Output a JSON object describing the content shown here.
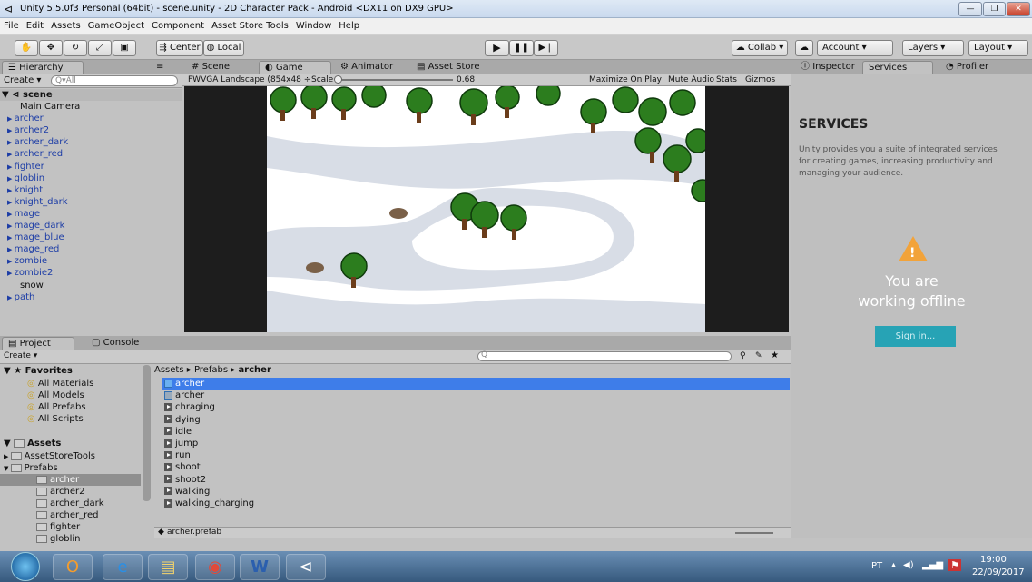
{
  "window": {
    "title": "Unity 5.5.0f3 Personal (64bit) - scene.unity - 2D Character Pack - Android <DX11 on DX9 GPU>",
    "controls": [
      "min",
      "max",
      "close"
    ]
  },
  "menubar": [
    "File",
    "Edit",
    "Assets",
    "GameObject",
    "Component",
    "Asset Store Tools",
    "Window",
    "Help"
  ],
  "toolbar": {
    "tools": [
      "hand",
      "move",
      "rotate",
      "scale",
      "rect"
    ],
    "pivot": "Center",
    "space": "Local",
    "collab": "Collab ▾",
    "account": "Account",
    "layers": "Layers",
    "layout": "Layout"
  },
  "hierarchy": {
    "tab": "Hierarchy",
    "create": "Create ▾",
    "search_placeholder": "Q▾All",
    "scene": "scene",
    "items": [
      "Main Camera",
      "archer",
      "archer2",
      "archer_dark",
      "archer_red",
      "fighter",
      "globlin",
      "knight",
      "knight_dark",
      "mage",
      "mage_dark",
      "mage_blue",
      "mage_red",
      "zombie",
      "zombie2",
      "snow",
      "path"
    ]
  },
  "center_tabs": [
    "Scene",
    "Game",
    "Animator",
    "Asset Store"
  ],
  "game_bar": {
    "resolution": "FWVGA Landscape (854x48 ÷",
    "scale_label": "Scale",
    "scale_value": "0.68",
    "maximize": "Maximize On Play",
    "mute": "Mute Audio",
    "stats": "Stats",
    "gizmos": "Gizmos"
  },
  "right_tabs": [
    "Inspector",
    "Services",
    "Profiler"
  ],
  "services": {
    "heading": "SERVICES",
    "description": "Unity provides you a suite of integrated services for creating games, increasing productivity and managing your audience.",
    "offline_line1": "You are",
    "offline_line2": "working offline",
    "signin": "Sign in..."
  },
  "project": {
    "tabs": [
      "Project",
      "Console"
    ],
    "create": "Create ▾",
    "favorites_label": "Favorites",
    "favorites": [
      "All Materials",
      "All Models",
      "All Prefabs",
      "All Scripts"
    ],
    "assets_label": "Assets",
    "assets_tree": [
      "AssetStoreTools",
      "Prefabs",
      "archer",
      "archer2",
      "archer_dark",
      "archer_red",
      "fighter",
      "globlin"
    ],
    "breadcrumb": [
      "Assets",
      "Prefabs",
      "archer"
    ],
    "files": [
      {
        "name": "archer",
        "icon": "prefab",
        "selected": true
      },
      {
        "name": "archer",
        "icon": "grid"
      },
      {
        "name": "chraging",
        "icon": "anim"
      },
      {
        "name": "dying",
        "icon": "anim"
      },
      {
        "name": "idle",
        "icon": "anim"
      },
      {
        "name": "jump",
        "icon": "anim"
      },
      {
        "name": "run",
        "icon": "anim"
      },
      {
        "name": "shoot",
        "icon": "anim"
      },
      {
        "name": "shoot2",
        "icon": "anim"
      },
      {
        "name": "walking",
        "icon": "anim"
      },
      {
        "name": "walking_charging",
        "icon": "anim"
      }
    ],
    "status_file": "archer.prefab"
  },
  "taskbar": {
    "apps": [
      "start",
      "outlook",
      "ie",
      "explorer",
      "chrome",
      "word",
      "unity"
    ],
    "lang": "PT",
    "time": "19:00",
    "date": "22/09/2017"
  }
}
